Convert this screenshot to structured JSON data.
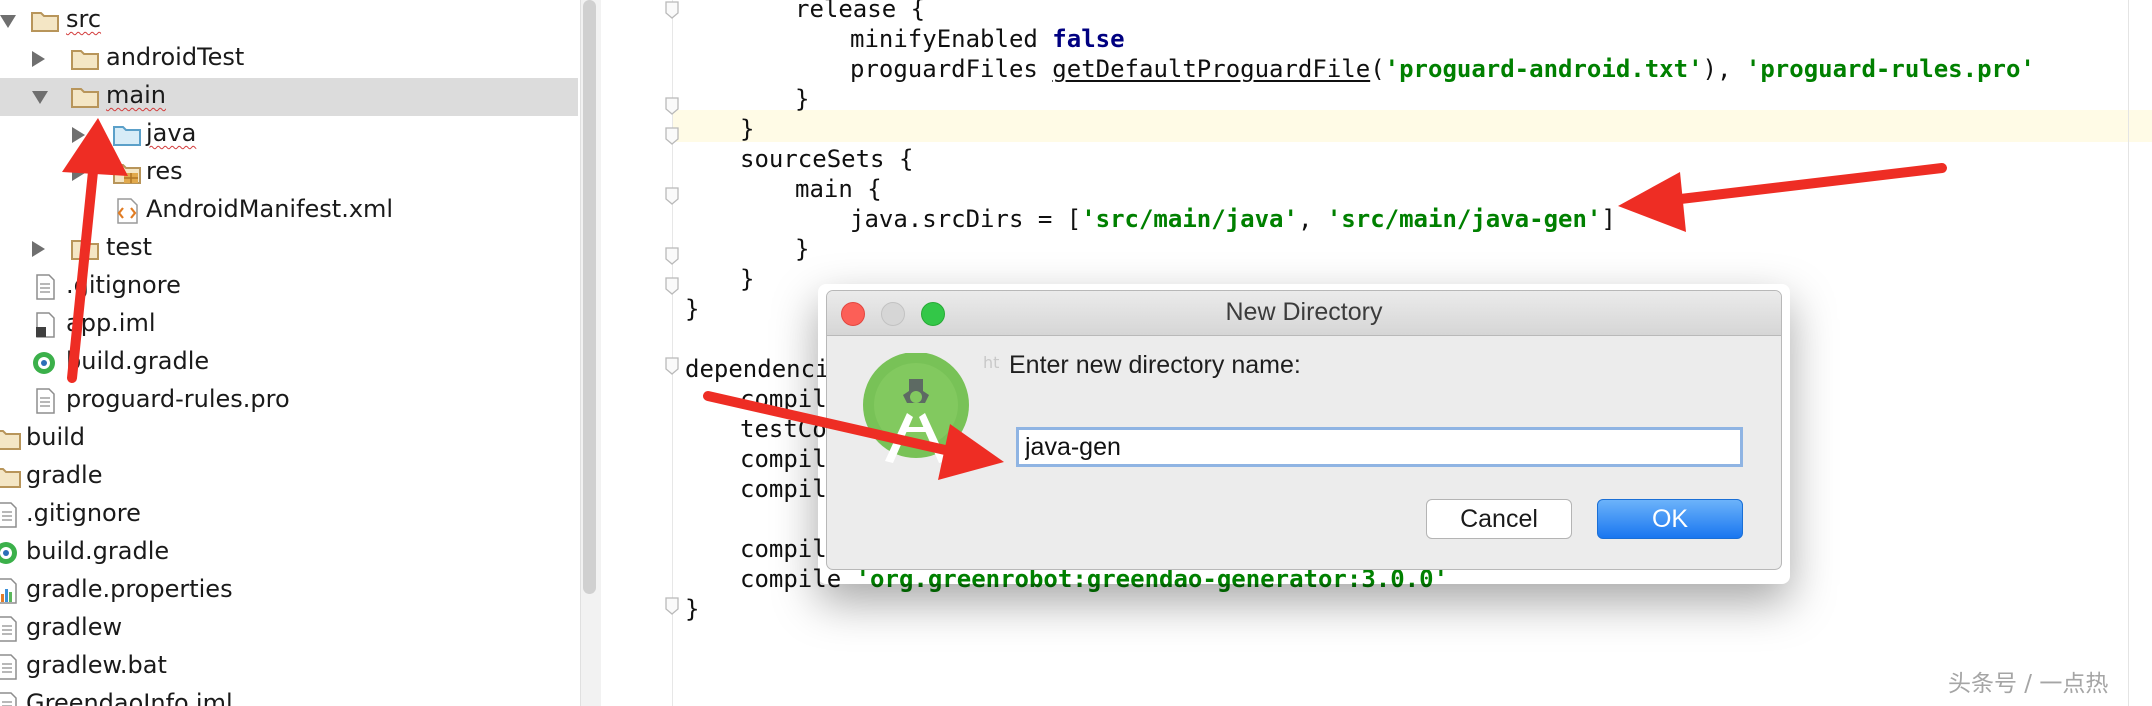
{
  "project_tree": {
    "items": [
      {
        "label": "src",
        "icon": "folder-icon",
        "expand": "down"
      },
      {
        "label": "androidTest",
        "icon": "folder-icon",
        "expand": "right"
      },
      {
        "label": "main",
        "icon": "folder-icon",
        "expand": "down",
        "selected": true
      },
      {
        "label": "java",
        "icon": "source-folder-icon",
        "expand": "right"
      },
      {
        "label": "res",
        "icon": "resources-folder-icon",
        "expand": "right"
      },
      {
        "label": "AndroidManifest.xml",
        "icon": "xml-file-icon",
        "expand": "none"
      },
      {
        "label": "test",
        "icon": "folder-icon",
        "expand": "right"
      },
      {
        "label": ".gitignore",
        "icon": "text-file-icon",
        "expand": "none"
      },
      {
        "label": "app.iml",
        "icon": "module-file-icon",
        "expand": "none"
      },
      {
        "label": "build.gradle",
        "icon": "gradle-file-icon",
        "expand": "none"
      },
      {
        "label": "proguard-rules.pro",
        "icon": "text-file-icon",
        "expand": "none"
      },
      {
        "label": "build",
        "icon": "folder-icon",
        "expand": "none"
      },
      {
        "label": "gradle",
        "icon": "folder-icon",
        "expand": "none"
      },
      {
        "label": ".gitignore",
        "icon": "text-file-icon",
        "expand": "none"
      },
      {
        "label": "build.gradle",
        "icon": "gradle-file-icon",
        "expand": "none"
      },
      {
        "label": "gradle.properties",
        "icon": "properties-file-icon",
        "expand": "none"
      },
      {
        "label": "gradlew",
        "icon": "text-file-icon",
        "expand": "none"
      },
      {
        "label": "gradlew.bat",
        "icon": "text-file-icon",
        "expand": "none"
      },
      {
        "label": "GreendaoInfo.iml",
        "icon": "text-file-icon",
        "expand": "none"
      }
    ]
  },
  "editor": {
    "lines": [
      [
        [
          "release {",
          "p"
        ]
      ],
      [
        [
          "minifyEnabled ",
          "p"
        ],
        [
          "false",
          "kw"
        ]
      ],
      [
        [
          "proguardFiles ",
          "p"
        ],
        [
          "getDefaultProguardFile",
          "u"
        ],
        [
          "(",
          "p"
        ],
        [
          "'proguard-android.txt'",
          "s"
        ],
        [
          "), ",
          "p"
        ],
        [
          "'proguard-rules.pro'",
          "s"
        ]
      ],
      [
        [
          "}",
          "p"
        ]
      ],
      [
        [
          "}",
          "p"
        ]
      ],
      [
        [
          "sourceSets {",
          "p"
        ]
      ],
      [
        [
          "main {",
          "p"
        ]
      ],
      [
        [
          "java.srcDirs = [",
          "p"
        ],
        [
          "'src/main/java'",
          "s"
        ],
        [
          ", ",
          "p"
        ],
        [
          "'src/main/java-gen'",
          "s"
        ],
        [
          "]",
          "p"
        ]
      ],
      [
        [
          "}",
          "p"
        ]
      ],
      [
        [
          "}",
          "p"
        ]
      ],
      [
        [
          "}",
          "p"
        ]
      ],
      [
        [
          "",
          "p"
        ]
      ],
      [
        [
          "dependencie",
          "p"
        ]
      ],
      [
        [
          "compil",
          "p"
        ]
      ],
      [
        [
          "testCo",
          "p"
        ]
      ],
      [
        [
          "compil",
          "p"
        ]
      ],
      [
        [
          "compil",
          "p"
        ]
      ],
      [
        [
          "",
          "p"
        ]
      ],
      [
        [
          "compil",
          "p"
        ]
      ],
      [
        [
          "compile ",
          "p"
        ],
        [
          "'org.greenrobot:greendao-generator:3.0.0'",
          "s"
        ]
      ],
      [
        [
          "}",
          "p"
        ]
      ]
    ]
  },
  "dialog": {
    "title": "New Directory",
    "prompt": "Enter new directory name:",
    "input_value": "java-gen",
    "cancel_label": "Cancel",
    "ok_label": "OK",
    "faint_text": "ht"
  },
  "watermark": "头条号 / 一点热",
  "colors": {
    "annotation_arrow": "#ee2d24",
    "string": "#008000",
    "keyword": "#000080",
    "ok_button": "#1976f0",
    "selection": "#dcdcdc"
  }
}
